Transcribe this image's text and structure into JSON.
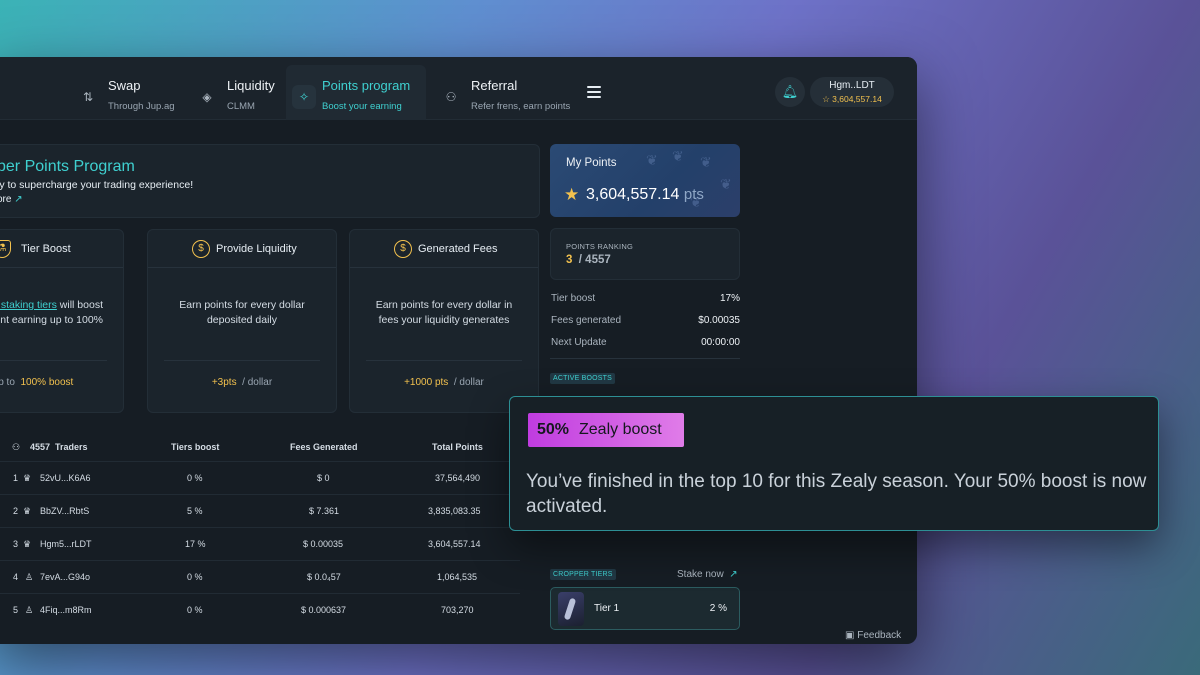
{
  "nav": {
    "items": [
      {
        "label": "Swap",
        "sub": "Through Jup.ag",
        "icon": "swap-icon"
      },
      {
        "label": "Liquidity",
        "sub": "CLMM",
        "icon": "droplet-icon"
      },
      {
        "label": "Points program",
        "sub": "Boost your earning",
        "icon": "sparkle-icon"
      },
      {
        "label": "Referral",
        "sub": "Refer frens, earn points",
        "icon": "user-plus-icon"
      }
    ],
    "active": "Points program"
  },
  "wallet": {
    "name": "Hgm..LDT",
    "points": "3,604,557.14"
  },
  "banner": {
    "title": "per Points Program",
    "desc": "ly to supercharge your trading experience!",
    "more": "ore"
  },
  "cards": [
    {
      "title": "Tier Boost",
      "body_link": "r staking tiers",
      "body_rest1": " will boost",
      "body_line2": "oint earning up to 100%",
      "footer_pre": "Up to",
      "footer_val": "100% boost",
      "footer_unit": ""
    },
    {
      "title": "Provide Liquidity",
      "body_line1": "Earn points for every dollar",
      "body_line2": "deposited daily",
      "footer_val": "+3pts",
      "footer_unit": "/ dollar"
    },
    {
      "title": "Generated Fees",
      "body_line1": "Earn points for every dollar in",
      "body_line2": "fees your liquidity generates",
      "footer_val": "+1000 pts",
      "footer_unit": "/ dollar"
    }
  ],
  "table": {
    "traders_count": "4557",
    "headers": {
      "traders": "Traders",
      "tiers": "Tiers boost",
      "fees": "Fees Generated",
      "total": "Total Points"
    },
    "rows": [
      {
        "rank": "1",
        "name": "52vU...K6A6",
        "tier": "0 %",
        "fees": "$ 0",
        "total": "37,564,490",
        "icon": "crown"
      },
      {
        "rank": "2",
        "name": "BbZV...RbtS",
        "tier": "5 %",
        "fees": "$ 7.361",
        "total": "3,835,083.35",
        "icon": "crown"
      },
      {
        "rank": "3",
        "name": "Hgm5...rLDT",
        "tier": "17 %",
        "fees": "$ 0.00035",
        "total": "3,604,557.14",
        "icon": "crown"
      },
      {
        "rank": "4",
        "name": "7evA...G94o",
        "tier": "0 %",
        "fees": "$ 0.0₄57",
        "total": "1,064,535",
        "icon": "person"
      },
      {
        "rank": "5",
        "name": "4Fiq...m8Rm",
        "tier": "0 %",
        "fees": "$ 0.000637",
        "total": "703,270",
        "icon": "person"
      }
    ]
  },
  "my_points": {
    "label": "My Points",
    "value": "3,604,557.14",
    "unit": "pts"
  },
  "ranking": {
    "label": "POINTS RANKING",
    "rank": "3",
    "total": "/ 4557"
  },
  "stats": [
    {
      "key": "Tier boost",
      "value": "17%"
    },
    {
      "key": "Fees generated",
      "value": "$0.00035"
    },
    {
      "key": "Next Update",
      "value": "00:00:00"
    }
  ],
  "active_boosts_label": "ACTIVE BOOSTS",
  "cropper_tiers_label": "CROPPER TIERS",
  "stake_now": "Stake now",
  "tier": {
    "name": "Tier 1",
    "pct": "2 %"
  },
  "feedback": "Feedback",
  "popup": {
    "pct": "50%",
    "name": "Zealy boost",
    "message": "You’ve finished in the top 10 for this Zealy season. Your 50% boost is now activated."
  },
  "colors": {
    "accent": "#3fd0d0",
    "gold": "#f2c14e",
    "badge_from": "#c03ce0",
    "badge_to": "#e07ce8"
  }
}
